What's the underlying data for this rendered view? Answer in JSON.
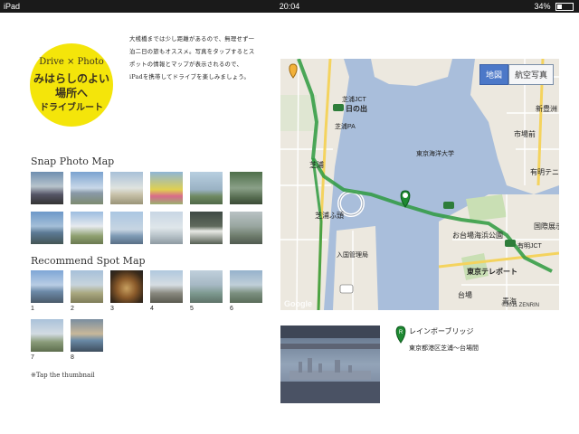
{
  "statusbar": {
    "device": "iPad",
    "time": "20:04",
    "battery": "34%",
    "battery_level": 0.34
  },
  "badge": {
    "line1": "Drive × Photo",
    "line2": "みはらしのよい",
    "line3": "場所へ",
    "line4": "ドライブルート"
  },
  "intro_text": "大桟橋までは少し距離があるので、無理せず一泊二日の旅もオススメ。写真をタップするとスポットの情報とマップが表示されるので、iPadを携帯してドライブを楽しみましょう。",
  "snap_photo_map": {
    "title": "Snap Photo Map"
  },
  "recommend_spot_map": {
    "title": "Recommend Spot Map",
    "numbers": [
      "1",
      "2",
      "3",
      "4",
      "5",
      "6",
      "7",
      "8"
    ]
  },
  "note": "※Tap the thumbnail",
  "map": {
    "tab_map": "地図",
    "tab_satellite": "航空写真",
    "copyright": "©2011 ZENRIN",
    "google": "Google",
    "labels": {
      "shibaura_jct": "芝浦JCT",
      "hinode": "日の出",
      "shibaura_pa": "芝浦PA",
      "shibaura": "芝浦",
      "shibaura_futo": "芝浦ふ頭",
      "daiba": "台場",
      "odaiba_kaihin_koen": "お台場海浜公園",
      "tokyo_teleport": "東京テレポート",
      "ariake_tennis": "有明テニスの森",
      "ichiba_mae": "市場前",
      "shin_toyosu": "新豊洲",
      "kokusai_tenjijo": "国際展示場",
      "ariake_jct": "有明JCT",
      "aomi": "青海",
      "nyukoku_kanri": "入国管理局",
      "tokyo_kaiyo_univ": "東京海洋大学"
    }
  },
  "spot": {
    "marker": "R",
    "title": "レインボーブリッジ",
    "address": "東京都港区芝浦～台場間"
  },
  "colors": {
    "badge": "#f4e50a",
    "water": "#a9bedb",
    "land": "#ece8df",
    "route": "#2e9a3f",
    "tab_active": "#4c78c8"
  }
}
